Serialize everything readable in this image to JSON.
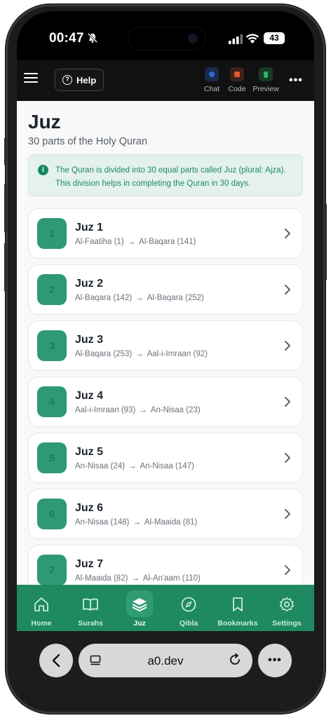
{
  "status_bar": {
    "time": "00:47",
    "battery": "43"
  },
  "topbar": {
    "help_label": "Help",
    "tools": [
      {
        "label": "Chat",
        "color": "#2f6bd8"
      },
      {
        "label": "Code",
        "color": "#d85a2f"
      },
      {
        "label": "Preview",
        "color": "#2fb36b"
      }
    ],
    "more": "•••"
  },
  "page": {
    "title": "Juz",
    "subtitle": "30 parts of the Holy Quran",
    "info": "The Quran is divided into 30 equal parts called Juz (plural: Ajza). This division helps in completing the Quran in 30 days."
  },
  "juz_list": [
    {
      "number": "1",
      "name": "Juz 1",
      "from": "Al-Faatiha (1)",
      "to": "Al-Baqara (141)"
    },
    {
      "number": "2",
      "name": "Juz 2",
      "from": "Al-Baqara (142)",
      "to": "Al-Baqara (252)"
    },
    {
      "number": "3",
      "name": "Juz 3",
      "from": "Al-Baqara (253)",
      "to": "Aal-i-Imraan (92)"
    },
    {
      "number": "4",
      "name": "Juz 4",
      "from": "Aal-i-Imraan (93)",
      "to": "An-Nisaa (23)"
    },
    {
      "number": "5",
      "name": "Juz 5",
      "from": "An-Nisaa (24)",
      "to": "An-Nisaa (147)"
    },
    {
      "number": "6",
      "name": "Juz 6",
      "from": "An-Nisaa (148)",
      "to": "Al-Maaida (81)"
    },
    {
      "number": "7",
      "name": "Juz 7",
      "from": "Al-Maaida (82)",
      "to": "Al-An'aam (110)"
    }
  ],
  "bottom_nav": [
    {
      "label": "Home",
      "icon": "home-icon"
    },
    {
      "label": "Surahs",
      "icon": "book-icon"
    },
    {
      "label": "Juz",
      "icon": "layers-icon",
      "active": true
    },
    {
      "label": "Qibla",
      "icon": "compass-icon"
    },
    {
      "label": "Bookmarks",
      "icon": "bookmark-icon"
    },
    {
      "label": "Settings",
      "icon": "gear-icon"
    }
  ],
  "browser": {
    "url": "a0.dev"
  },
  "colors": {
    "accent": "#1f8a62",
    "badge": "#2d9a74",
    "info_bg": "#e4f1ec"
  }
}
